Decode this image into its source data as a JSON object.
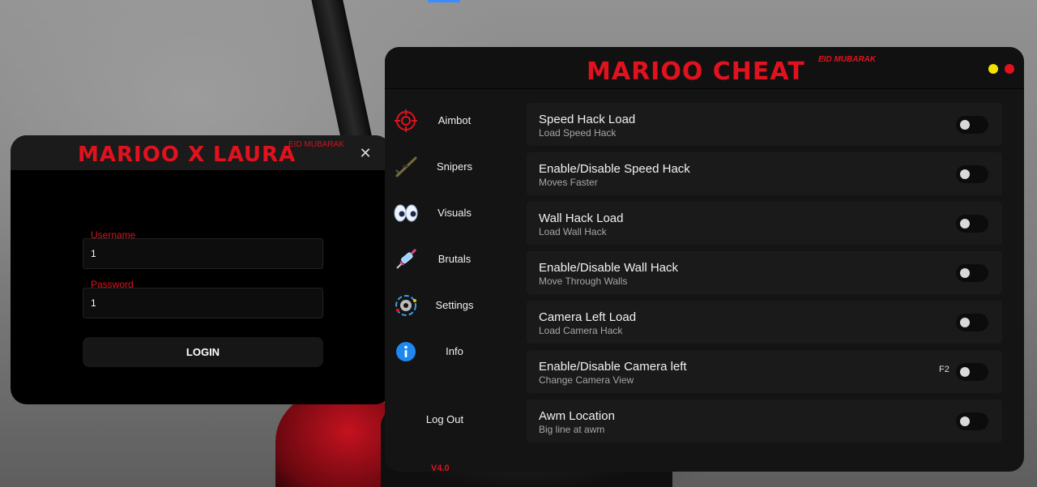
{
  "colors": {
    "accent_red": "#e1121e",
    "window_bg": "#141414",
    "row_bg": "#1a1a1a",
    "dot_yellow": "#f2e300",
    "dot_red": "#e1121e"
  },
  "login_window": {
    "title": "MARIOO X LAURA",
    "subtitle": "EID MUBARAK",
    "close_icon": "close-icon",
    "username_label": "Username",
    "username_value": "1",
    "password_label": "Password",
    "password_value": "1",
    "login_button": "LOGIN"
  },
  "cheat_window": {
    "title": "MARIOO CHEAT",
    "subtitle": "EID MUBARAK",
    "window_dots": [
      "yellow",
      "red"
    ],
    "nav": [
      {
        "label": "Aimbot",
        "icon": "crosshair-icon"
      },
      {
        "label": "Snipers",
        "icon": "sniper-rifle-icon"
      },
      {
        "label": "Visuals",
        "icon": "eyes-icon"
      },
      {
        "label": "Brutals",
        "icon": "syringe-icon"
      },
      {
        "label": "Settings",
        "icon": "gear-icon"
      },
      {
        "label": "Info",
        "icon": "info-icon"
      }
    ],
    "logout": "Log Out",
    "version": "V4.0",
    "options": [
      {
        "title": "Speed Hack Load",
        "subtitle": "Load Speed Hack",
        "key": "",
        "enabled": false
      },
      {
        "title": "Enable/Disable Speed Hack",
        "subtitle": "Moves Faster",
        "key": "",
        "enabled": false
      },
      {
        "title": "Wall Hack Load",
        "subtitle": "Load Wall Hack",
        "key": "",
        "enabled": false
      },
      {
        "title": "Enable/Disable Wall Hack",
        "subtitle": "Move Through Walls",
        "key": "",
        "enabled": false
      },
      {
        "title": "Camera Left Load",
        "subtitle": "Load Camera Hack",
        "key": "",
        "enabled": false
      },
      {
        "title": "Enable/Disable Camera left",
        "subtitle": "Change Camera View",
        "key": "F2",
        "enabled": false
      },
      {
        "title": "Awm Location",
        "subtitle": "Big line at awm",
        "key": "",
        "enabled": false
      }
    ]
  }
}
